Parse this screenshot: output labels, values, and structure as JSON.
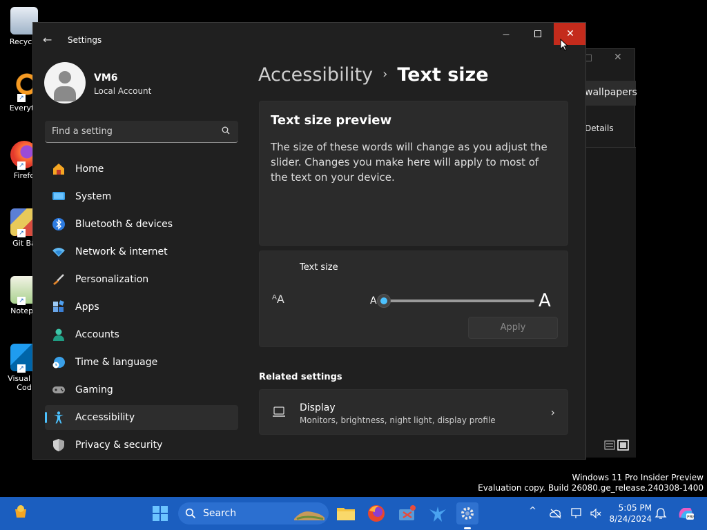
{
  "desktop": {
    "icons": [
      {
        "label": "Recycle"
      },
      {
        "label": "Everyth"
      },
      {
        "label": "Firefo"
      },
      {
        "label": "Git Ba"
      },
      {
        "label": "Notepa"
      },
      {
        "label": "Visual St"
      },
      {
        "label": "Cod"
      }
    ]
  },
  "background_window": {
    "breadcrumb": "wallpapers",
    "details_label": "Details"
  },
  "window": {
    "title": "Settings",
    "back_glyph": "←",
    "minimize_glyph": "—",
    "close_glyph": "✕"
  },
  "profile": {
    "name": "VM6",
    "account_type": "Local Account"
  },
  "search": {
    "placeholder": "Find a setting"
  },
  "nav": {
    "items": [
      {
        "label": "Home"
      },
      {
        "label": "System"
      },
      {
        "label": "Bluetooth & devices"
      },
      {
        "label": "Network & internet"
      },
      {
        "label": "Personalization"
      },
      {
        "label": "Apps"
      },
      {
        "label": "Accounts"
      },
      {
        "label": "Time & language"
      },
      {
        "label": "Gaming"
      },
      {
        "label": "Accessibility"
      },
      {
        "label": "Privacy & security"
      }
    ]
  },
  "breadcrumb": {
    "parent": "Accessibility",
    "separator": "›",
    "current": "Text size"
  },
  "preview": {
    "heading": "Text size preview",
    "text": "The size of these words will change as you adjust the slider. Changes you make here will apply to most of the text on your device."
  },
  "text_size": {
    "label": "Text size",
    "small_label": "A",
    "large_label": "A",
    "icon_glyph": "ᴬA",
    "slider_fraction": 0.0,
    "apply_label": "Apply"
  },
  "related": {
    "heading": "Related settings",
    "display": {
      "title": "Display",
      "subtitle": "Monitors, brightness, night light, display profile",
      "chevron": "›"
    }
  },
  "watermark": {
    "line1": "Windows 11 Pro Insider Preview",
    "line2": "Evaluation copy. Build 26080.ge_release.240308-1400"
  },
  "taskbar": {
    "search_label": "Search",
    "tray_chevron": "^",
    "time": "5:05 PM",
    "date": "8/24/2024"
  },
  "colors": {
    "accent": "#4cc2ff",
    "close_red": "#c42b1c",
    "taskbar": "#1b5ebf"
  }
}
